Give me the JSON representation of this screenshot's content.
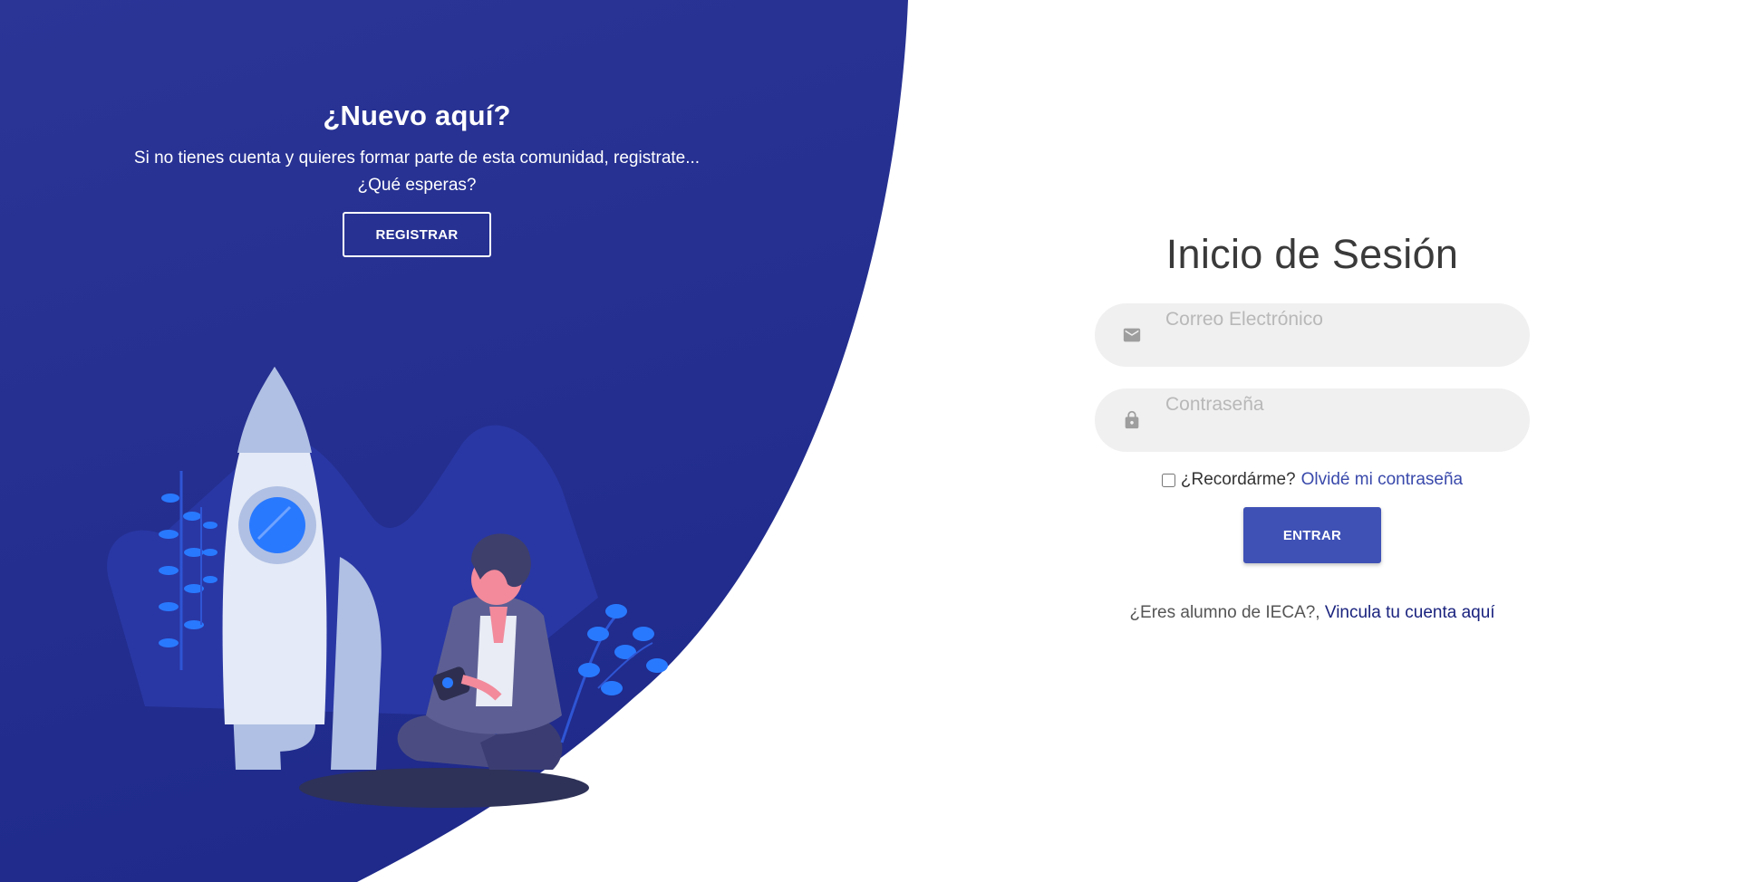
{
  "left": {
    "title": "¿Nuevo aquí?",
    "text": "Si no tienes cuenta y quieres formar parte de esta comunidad, registrate... ¿Qué esperas?",
    "register_label": "REGISTRAR"
  },
  "login": {
    "title": "Inicio de Sesión",
    "email_placeholder": "Correo Electrónico",
    "password_placeholder": "Contraseña",
    "remember_label": "¿Recordárme?",
    "forgot_label": "Olvidé mi contraseña",
    "enter_label": "ENTRAR",
    "ieca_prompt": "¿Eres alumno de IECA?,",
    "ieca_link": "Vincula tu cuenta aquí"
  },
  "icons": {
    "email": "mail-icon",
    "password": "lock-icon"
  },
  "colors": {
    "panel_blue": "#283593",
    "button_blue": "#3f51b5",
    "link_dark": "#1a237e",
    "field_bg": "#f0f0f0"
  }
}
